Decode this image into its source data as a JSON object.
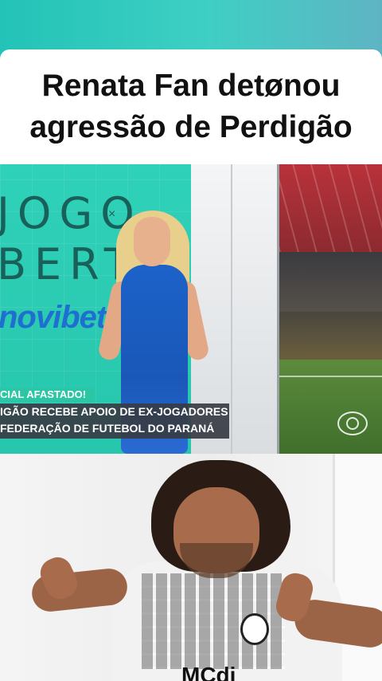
{
  "caption": {
    "line1": "Renata Fan detønou",
    "line2": "agressão de Perdigão"
  },
  "tv_clip": {
    "show_logo_line1": "JOGO",
    "show_logo_line2": "BERTO",
    "show_logo_x": "×",
    "sponsor": "novibet",
    "lower_third": {
      "tag": "CIAL AFASTADO!",
      "line1": "IGÃO RECEBE APOIO DE EX-JOGADORES",
      "line2": "FEDERAÇÃO DE FUTEBOL DO PARANÁ"
    }
  },
  "player_clip": {
    "shirt_sponsor": "MCdi"
  }
}
